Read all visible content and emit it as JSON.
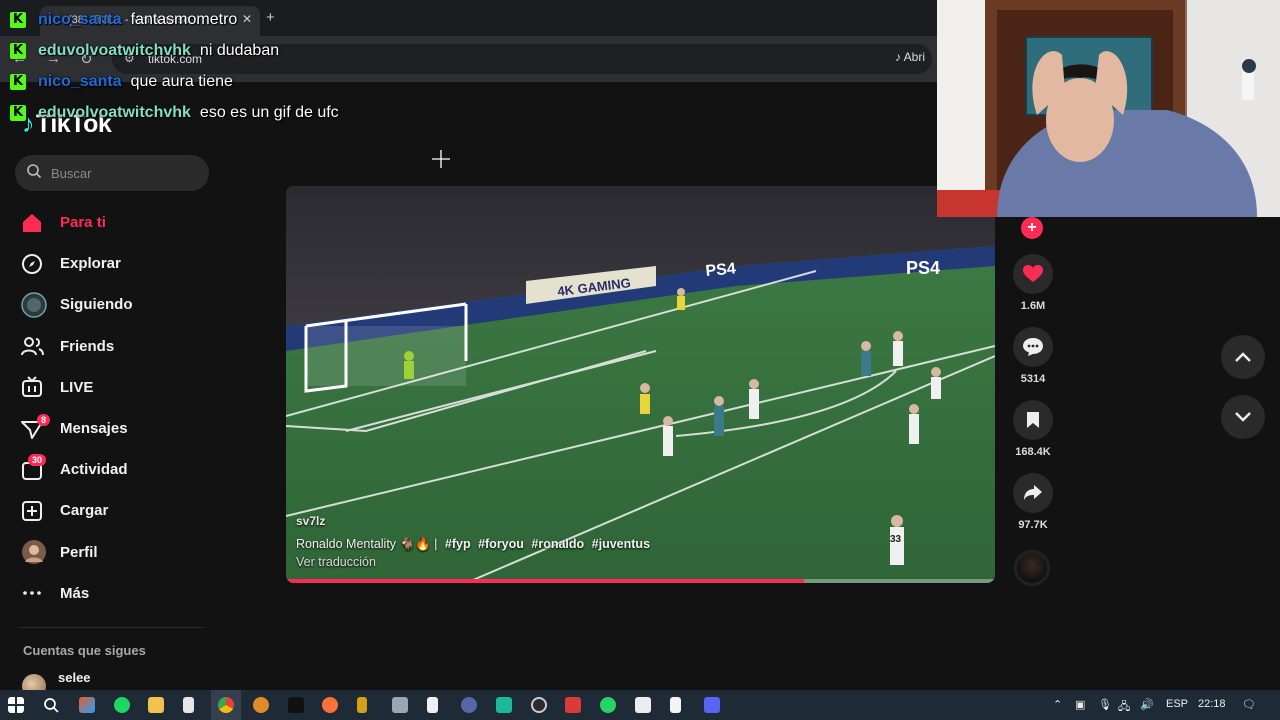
{
  "browser": {
    "tab_title": "(38) TikTok - Mantenerse...",
    "tab_close": "✕",
    "new_tab": "+",
    "url": "tiktok.com",
    "open_app": "Abri"
  },
  "tiktok": {
    "logo": "TikTok",
    "search_placeholder": "Buscar",
    "nav": [
      {
        "label": "Para ti",
        "icon": "home-icon"
      },
      {
        "label": "Explorar",
        "icon": "compass-icon"
      },
      {
        "label": "Siguiendo",
        "icon": "following-icon"
      },
      {
        "label": "Friends",
        "icon": "friends-icon"
      },
      {
        "label": "LIVE",
        "icon": "live-icon"
      },
      {
        "label": "Mensajes",
        "icon": "messages-icon",
        "badge": "8"
      },
      {
        "label": "Actividad",
        "icon": "activity-icon",
        "badge": "30"
      },
      {
        "label": "Cargar",
        "icon": "upload-icon"
      },
      {
        "label": "Perfil",
        "icon": "profile-icon"
      },
      {
        "label": "Más",
        "icon": "more-icon"
      }
    ],
    "following_title": "Cuentas que sigues",
    "following_account": "selee",
    "video": {
      "username": "sv7lz",
      "caption_text": "Ronaldo Mentality 🐐🔥 |",
      "hashtags": [
        "#fyp",
        "#foryou",
        "#ronaldo",
        "#juventus"
      ],
      "translate": "Ver traducción",
      "progress": 0.73,
      "board_text_1": "4K GAMING",
      "board_text_2": "PS4",
      "board_text_3": "PS4",
      "player_number": "33"
    },
    "actions": {
      "likes": "1.6M",
      "comments": "5314",
      "saves": "168.4K",
      "shares": "97.7K"
    },
    "accent": "#fe2c55"
  },
  "chat": [
    {
      "user": "nico_santa",
      "color": "#1e6bd6",
      "message": "fantasmometro"
    },
    {
      "user": "eduvolvoatwitchvhk",
      "color": "#7fe0c2",
      "message": "ni dudaban"
    },
    {
      "user": "nico_santa",
      "color": "#1e6bd6",
      "message": "que aura tiene"
    },
    {
      "user": "eduvolvoatwitchvhk",
      "color": "#7fe0c2",
      "message": "eso es un gif de ufc"
    }
  ],
  "chat_icon": "K",
  "taskbar": {
    "language": "ESP",
    "time": "22:18"
  }
}
